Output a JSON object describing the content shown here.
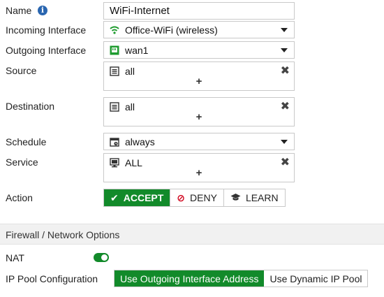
{
  "form": {
    "name": {
      "label": "Name",
      "value": "WiFi-Internet",
      "info_icon": "info-icon"
    },
    "incoming": {
      "label": "Incoming Interface",
      "value": "Office-WiFi (wireless)",
      "icon": "wifi-icon",
      "icon_color": "#1e9b2e"
    },
    "outgoing": {
      "label": "Outgoing Interface",
      "value": "wan1",
      "icon": "ethernet-port-icon",
      "icon_color": "#1e9b2e"
    },
    "source": {
      "label": "Source",
      "value": "all",
      "icon": "address-icon",
      "add_label": "+",
      "remove_label": "✖"
    },
    "destination": {
      "label": "Destination",
      "value": "all",
      "icon": "address-icon",
      "add_label": "+",
      "remove_label": "✖"
    },
    "schedule": {
      "label": "Schedule",
      "value": "always",
      "icon": "schedule-icon"
    },
    "service": {
      "label": "Service",
      "value": "ALL",
      "icon": "service-icon",
      "add_label": "+",
      "remove_label": "✖"
    },
    "action": {
      "label": "Action",
      "options": [
        {
          "label": "ACCEPT",
          "glyph": "✔",
          "selected": true
        },
        {
          "label": "DENY",
          "glyph": "⊘",
          "selected": false
        },
        {
          "label": "LEARN",
          "glyph": "🎓",
          "selected": false
        }
      ]
    }
  },
  "firewall_options": {
    "title": "Firewall / Network Options",
    "nat": {
      "label": "NAT",
      "enabled": true
    },
    "ip_pool": {
      "label": "IP Pool Configuration",
      "options": [
        {
          "label": "Use Outgoing Interface Address",
          "selected": true
        },
        {
          "label": "Use Dynamic IP Pool",
          "selected": false
        }
      ]
    }
  },
  "colors": {
    "accent": "#128a2a",
    "info": "#2a66b0",
    "border": "#c9c9c9"
  }
}
